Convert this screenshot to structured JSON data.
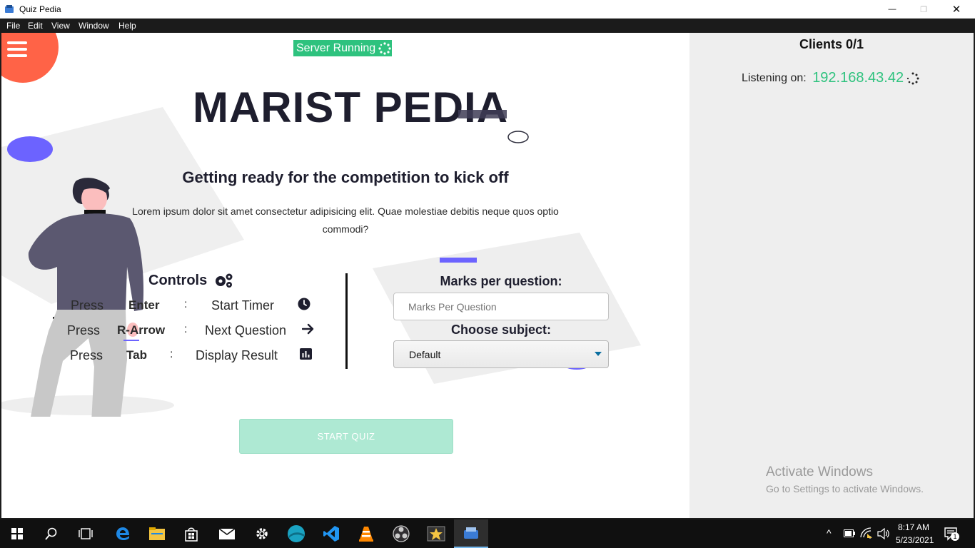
{
  "window": {
    "title": "Quiz Pedia",
    "minimize_glyph": "—",
    "maximize_glyph": "❐",
    "close_glyph": "✕"
  },
  "menubar": {
    "items": [
      "File",
      "Edit",
      "View",
      "Window",
      "Help"
    ]
  },
  "main": {
    "server_status": "Server Running",
    "heading": "MARIST PEDIA",
    "subheading": "Getting ready for the competition to kick off",
    "description_line1": "Lorem ipsum dolor sit amet consectetur adipisicing elit. Quae molestiae debitis neque quos optio",
    "description_line2": "commodi?",
    "controls": {
      "title": "Controls",
      "rows": [
        {
          "press": "Press",
          "key": "Enter",
          "sep": ":",
          "action": "Start Timer",
          "icon": "clock-icon"
        },
        {
          "press": "Press",
          "key": "R-Arrow",
          "sep": ":",
          "action": "Next Question",
          "icon": "arrow-right-icon"
        },
        {
          "press": "Press",
          "key": "Tab",
          "sep": ":",
          "action": "Display Result",
          "icon": "bar-chart-icon"
        }
      ]
    },
    "form": {
      "marks_label": "Marks per question:",
      "marks_placeholder": "Marks Per Question",
      "marks_value": "",
      "subject_label": "Choose subject:",
      "subject_selected": "Default"
    },
    "start_button": "START QUIZ",
    "colors": {
      "accent_green": "#2ec27e",
      "start_button_bg": "#aee9d3",
      "purple": "#6c63ff",
      "coral": "#ff6347",
      "heading": "#1e1e2e"
    }
  },
  "sidebar": {
    "clients": "Clients 0/1",
    "listening_label": "Listening on: ",
    "ip": "192.168.43.42"
  },
  "watermark": {
    "title": "Activate Windows",
    "subtitle": "Go to Settings to activate Windows."
  },
  "taskbar": {
    "apps": [
      "start-icon",
      "search-icon",
      "task-view-icon",
      "edge-icon",
      "file-explorer-icon",
      "store-icon",
      "mail-icon",
      "settings-icon",
      "app-globe-icon",
      "vscode-icon",
      "vlc-icon",
      "obs-icon",
      "movie-maker-icon",
      "quiz-pedia-icon"
    ],
    "time": "8:17 AM",
    "date": "5/23/2021",
    "notification_count": "1"
  }
}
